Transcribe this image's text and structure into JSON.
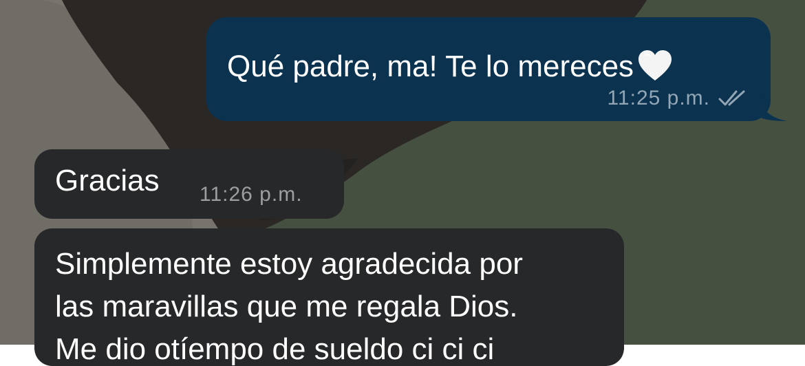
{
  "theme": {
    "outgoing_bubble": "#0b3350",
    "incoming_bubble": "#26282a",
    "outgoing_meta": "#93a6b5",
    "incoming_meta": "#9c9fa2",
    "wallpaper_dark": "#2a2724",
    "wallpaper_olive": "#455040",
    "wallpaper_gray": "#76746d"
  },
  "messages": [
    {
      "direction": "outgoing",
      "text": "Qué padre, ma! Te lo mereces",
      "emoji": "white-heart",
      "time": "11:25 p.m.",
      "status_icon": "double-check-icon"
    },
    {
      "direction": "incoming",
      "text": "Gracias",
      "time": "11:26 p.m."
    },
    {
      "direction": "incoming",
      "lines": [
        "Simplemente estoy agradecida por",
        "las maravillas que me regala Dios.",
        "Me dio otíempo de sueldo ci ci ci"
      ]
    }
  ]
}
